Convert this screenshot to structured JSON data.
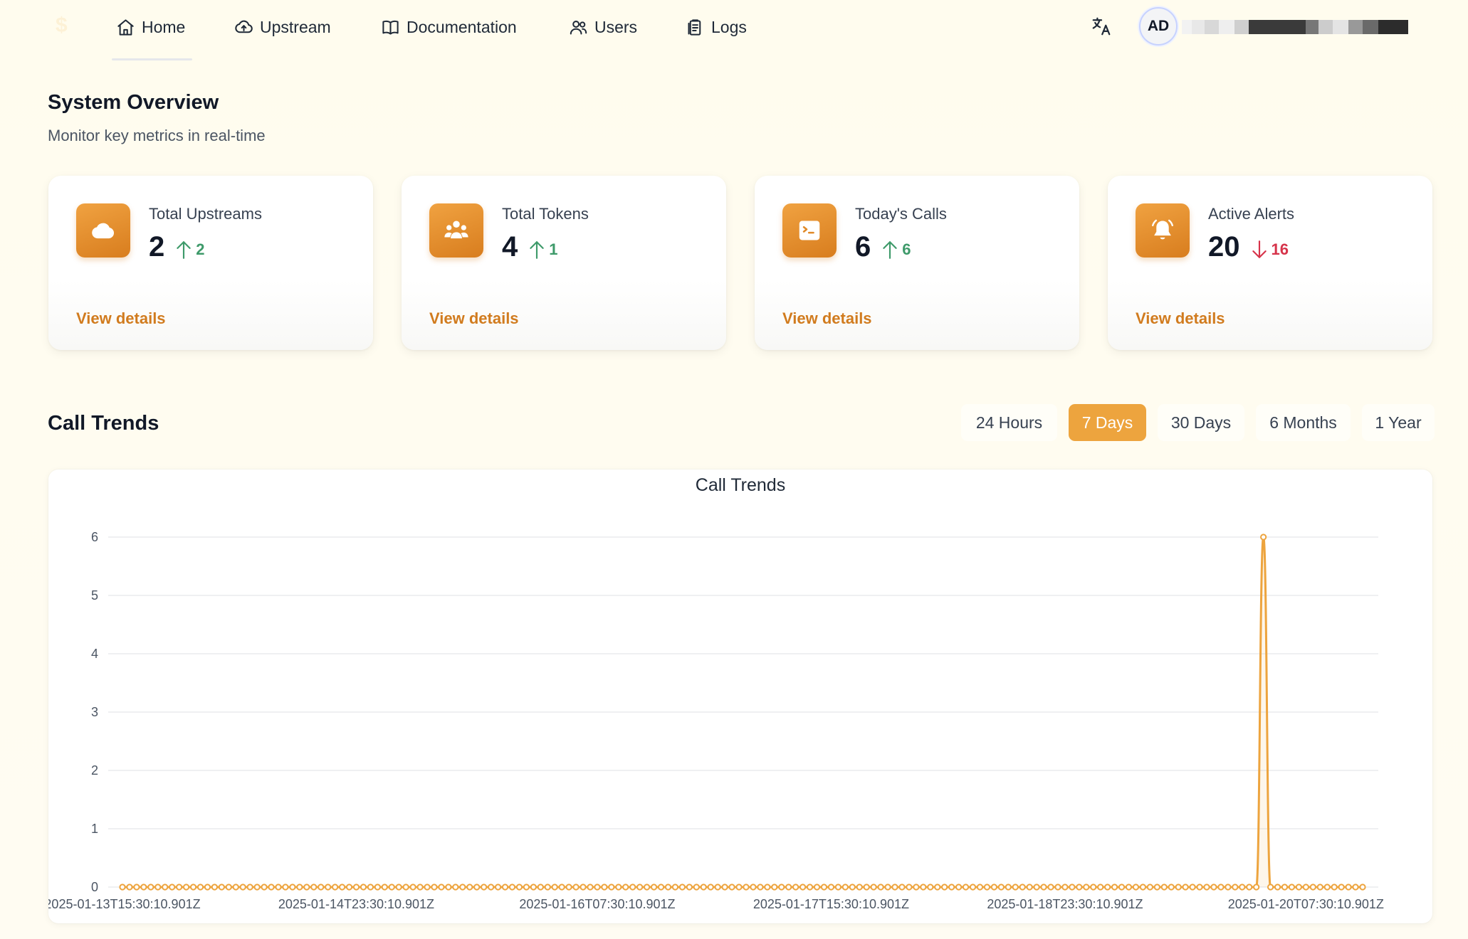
{
  "nav": {
    "logo": "$",
    "items": [
      {
        "label": "Home",
        "icon": "home-icon"
      },
      {
        "label": "Upstream",
        "icon": "cloud-upload-icon"
      },
      {
        "label": "Documentation",
        "icon": "book-icon"
      },
      {
        "label": "Users",
        "icon": "users-icon"
      },
      {
        "label": "Logs",
        "icon": "clipboard-icon"
      }
    ],
    "active": "Home",
    "translate_icon": "translate-icon",
    "avatar_initials": "AD"
  },
  "overview": {
    "title": "System Overview",
    "subtitle": "Monitor key metrics in real-time"
  },
  "cards": [
    {
      "label": "Total Upstreams",
      "value": "2",
      "trend": "2",
      "direction": "up",
      "icon": "cloud-icon",
      "link": "View details"
    },
    {
      "label": "Total Tokens",
      "value": "4",
      "trend": "1",
      "direction": "up",
      "icon": "users-group-icon",
      "link": "View details"
    },
    {
      "label": "Today's Calls",
      "value": "6",
      "trend": "6",
      "direction": "up",
      "icon": "terminal-icon",
      "link": "View details"
    },
    {
      "label": "Active Alerts",
      "value": "20",
      "trend": "16",
      "direction": "down",
      "icon": "bell-icon",
      "link": "View details"
    }
  ],
  "colors": {
    "accent": "#eda43e",
    "icon_gradient_start": "#f0a241",
    "icon_gradient_end": "#d87d1e",
    "link": "#d17b1e",
    "trend_up": "#3e9a6a",
    "trend_down": "#d6334a",
    "line": "#eda43e"
  },
  "trends": {
    "title": "Call Trends",
    "ranges": [
      "24 Hours",
      "7 Days",
      "30 Days",
      "6 Months",
      "1 Year"
    ],
    "active_range": "7 Days"
  },
  "chart_data": {
    "type": "line",
    "title": "Call Trends",
    "xlabel": "",
    "ylabel": "",
    "ylim": [
      0,
      6
    ],
    "yticks": [
      0,
      1,
      2,
      3,
      4,
      5,
      6
    ],
    "grid": true,
    "fill": true,
    "x_tick_labels": [
      "2025-01-13T15:30:10.901Z",
      "2025-01-14T23:30:10.901Z",
      "2025-01-16T07:30:10.901Z",
      "2025-01-17T15:30:10.901Z",
      "2025-01-18T23:30:10.901Z",
      "2025-01-20T07:30:10.901Z"
    ],
    "series": [
      {
        "values": [
          0,
          0,
          0,
          0,
          0,
          0,
          0,
          0,
          0,
          0,
          0,
          0,
          0,
          0,
          0,
          0,
          0,
          0,
          0,
          0,
          0,
          0,
          0,
          0,
          0,
          0,
          0,
          0,
          0,
          0,
          0,
          0,
          0,
          0,
          0,
          0,
          0,
          0,
          0,
          0,
          0,
          0,
          0,
          0,
          0,
          0,
          0,
          0,
          0,
          0,
          0,
          0,
          0,
          0,
          0,
          0,
          0,
          0,
          0,
          0,
          0,
          0,
          0,
          0,
          0,
          0,
          0,
          0,
          0,
          0,
          0,
          0,
          0,
          0,
          0,
          0,
          0,
          0,
          0,
          0,
          0,
          0,
          0,
          0,
          0,
          0,
          0,
          0,
          0,
          0,
          0,
          0,
          0,
          0,
          0,
          0,
          0,
          0,
          0,
          0,
          0,
          0,
          0,
          0,
          0,
          0,
          0,
          0,
          0,
          0,
          0,
          0,
          0,
          0,
          0,
          0,
          0,
          0,
          0,
          0,
          0,
          0,
          0,
          0,
          0,
          0,
          0,
          0,
          0,
          0,
          0,
          0,
          0,
          0,
          0,
          0,
          0,
          0,
          0,
          0,
          0,
          0,
          0,
          0,
          0,
          0,
          0,
          0,
          0,
          0,
          0,
          0,
          0,
          0,
          0,
          0,
          0,
          0,
          0,
          0,
          0,
          6,
          0,
          0,
          0,
          0,
          0,
          0,
          0,
          0,
          0,
          0,
          0,
          0,
          0,
          0
        ]
      }
    ]
  }
}
